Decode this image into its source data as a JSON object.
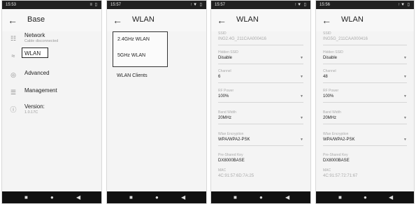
{
  "panels": [
    {
      "status_time": "15:53",
      "status_icons": "≡ ▯",
      "title": "Base",
      "menu": [
        {
          "label": "Network",
          "sub": "Cable disconnected"
        },
        {
          "label": "WLAN"
        },
        {
          "label": "Advanced"
        },
        {
          "label": "Management"
        },
        {
          "label": "Version:",
          "sub": "1.0.17C"
        }
      ]
    },
    {
      "status_time": "15:57",
      "status_icons": "↑▼ ▯",
      "title": "WLAN",
      "items": [
        "2.4GHz WLAN",
        "5GHz WLAN",
        "WLAN Clients"
      ]
    },
    {
      "status_time": "15:57",
      "status_icons": "↑▼ ▯",
      "title": "WLAN",
      "fields": {
        "ssid_label": "SSID",
        "ssid": "ING2.4G_211CAA000416",
        "hidden_label": "Hidden SSID",
        "hidden": "Disable",
        "channel_label": "Channel",
        "channel": "6",
        "power_label": "RF Power",
        "power": "100%",
        "bw_label": "Band Width",
        "bw": "20MHz",
        "enc_label": "Wlan Encryption",
        "enc": "WPA/WPA2-PSK",
        "psk_label": "Pre-Shared Key",
        "psk": "DX8000BASE",
        "mac_label": "MAC",
        "mac": "4C:91:57:6D:7A:25"
      }
    },
    {
      "status_time": "15:56",
      "status_icons": "↑▼ ▯",
      "title": "WLAN",
      "fields": {
        "ssid_label": "SSID",
        "ssid": "ING5G_211CAA000416",
        "hidden_label": "Hidden SSID",
        "hidden": "Disable",
        "channel_label": "Channel",
        "channel": "48",
        "power_label": "RF Power",
        "power": "100%",
        "bw_label": "Band Width",
        "bw": "20MHz",
        "enc_label": "Wlan Encryption",
        "enc": "WPA/WPA2-PSK",
        "psk_label": "Pre-Shared Key",
        "psk": "DX8000BASE",
        "mac_label": "MAC",
        "mac": "4C:91:57:72:71:67"
      }
    }
  ],
  "icons": {
    "back": "←",
    "nav_home": "●",
    "nav_back": "◀",
    "nav_recent": "■"
  }
}
